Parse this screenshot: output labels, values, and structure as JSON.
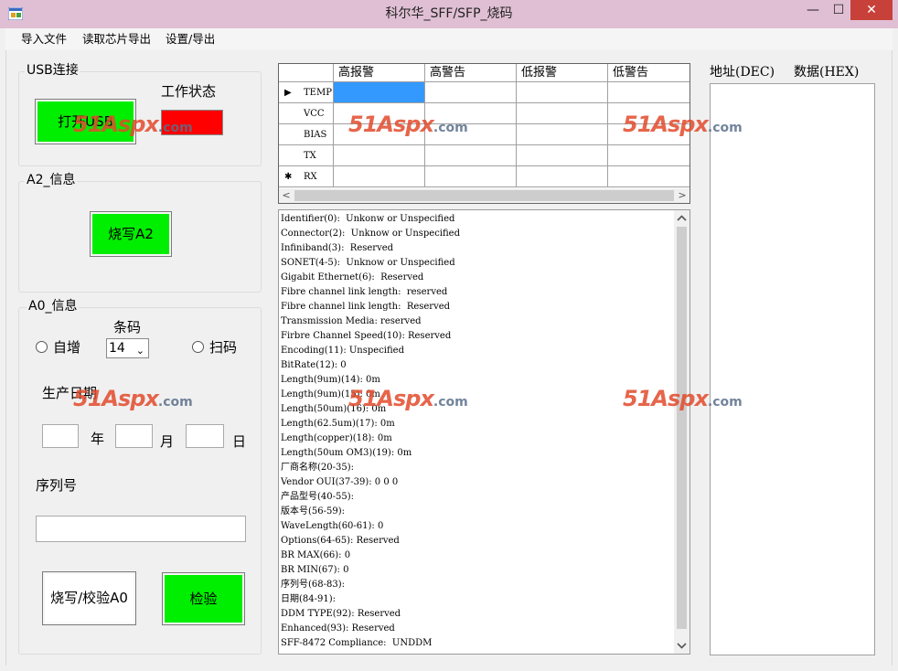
{
  "window": {
    "title": "科尔华_SFF/SFP_烧码",
    "min": "—",
    "max": "☐",
    "close": "✕"
  },
  "menu": [
    "导入文件",
    "读取芯片导出",
    "设置/导出"
  ],
  "usb": {
    "group": "USB连接",
    "status_label": "工作状态",
    "open_button": "打开USB",
    "status_color": "#ff0000"
  },
  "a2": {
    "group": "A2_信息",
    "write_button": "烧写A2"
  },
  "a0": {
    "group": "A0_信息",
    "barcode_label": "条码",
    "auto_inc": "自增",
    "scan": "扫码",
    "barcode_value": "14",
    "date_label": "生产日期",
    "year": "年",
    "month": "月",
    "day": "日",
    "serial_label": "序列号",
    "write_verify_button": "烧写/校验A0",
    "verify_button": "检验"
  },
  "grid": {
    "columns": [
      "高报警",
      "高警告",
      "低报警",
      "低警告"
    ],
    "rows": [
      {
        "marker": "▶",
        "name": "TEMP"
      },
      {
        "marker": "",
        "name": "VCC"
      },
      {
        "marker": "",
        "name": "BIAS"
      },
      {
        "marker": "",
        "name": "TX"
      },
      {
        "marker": "✱",
        "name": "RX"
      }
    ],
    "scroll_left": "<",
    "scroll_right": ">"
  },
  "info_lines": [
    "Identifier(0):  Unkonw or Unspecified",
    "Connector(2):  Unknow or Unspecified",
    "Infiniband(3):  Reserved",
    "SONET(4-5):  Unknow or Unspecified",
    "Gigabit Ethernet(6):  Reserved",
    "Fibre channel link length:  reserved",
    "Fibre channel link length:  Reserved",
    "Transmission Media: reserved",
    "Firbre Channel Speed(10): Reserved",
    "Encoding(11): Unspecified",
    "BitRate(12): 0",
    "Length(9um)(14): 0m",
    "Length(9um)(15): 0m",
    "Length(50um)(16): 0m",
    "Length(62.5um)(17): 0m",
    "Length(copper)(18): 0m",
    "Length(50um OM3)(19): 0m",
    "厂商名称(20-35):",
    "Vendor OUI(37-39): 0 0 0",
    "产品型号(40-55):",
    "版本号(56-59):",
    "WaveLength(60-61): 0",
    "Options(64-65): Reserved",
    "BR MAX(66): 0",
    "BR MIN(67): 0",
    "序列号(68-83):",
    "日期(84-91):",
    "DDM TYPE(92): Reserved",
    "Enhanced(93): Reserved",
    "SFF-8472 Compliance:  UNDDM"
  ],
  "address_header": "地址(DEC)",
  "data_header": "数据(HEX)",
  "watermark": {
    "brand": "51Aspx",
    "suffix": ".com"
  },
  "colors": {
    "green_button": "#00ee00",
    "selected_cell": "#3399ff",
    "close_button": "#c7413a"
  }
}
